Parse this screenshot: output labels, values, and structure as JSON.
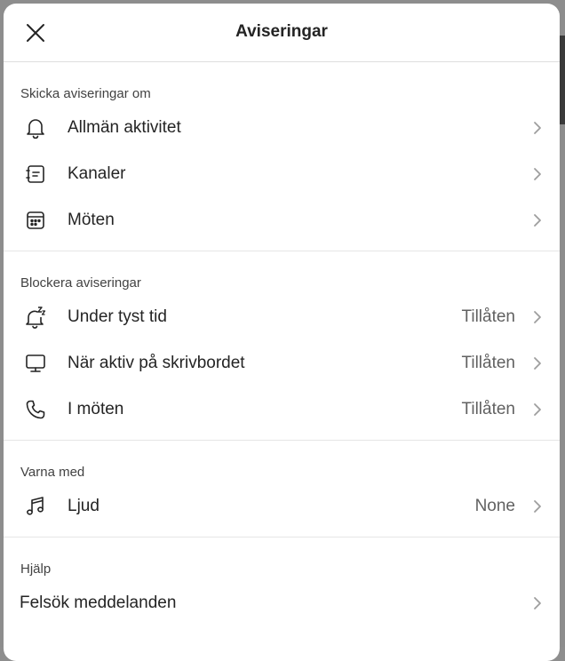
{
  "header": {
    "title": "Aviseringar"
  },
  "sections": [
    {
      "title": "Skicka aviseringar om",
      "items": [
        {
          "label": "Allmän aktivitet",
          "value": ""
        },
        {
          "label": "Kanaler",
          "value": ""
        },
        {
          "label": "Möten",
          "value": ""
        }
      ]
    },
    {
      "title": "Blockera aviseringar",
      "items": [
        {
          "label": "Under tyst tid",
          "value": "Tillåten"
        },
        {
          "label": "När aktiv på skrivbordet",
          "value": "Tillåten"
        },
        {
          "label": "I möten",
          "value": "Tillåten"
        }
      ]
    },
    {
      "title": "Varna med",
      "items": [
        {
          "label": "Ljud",
          "value": "None"
        }
      ]
    },
    {
      "title": "Hjälp",
      "items": [
        {
          "label": "Felsök meddelanden",
          "value": ""
        }
      ]
    }
  ],
  "icons": {
    "close": "close-icon",
    "chevron": "chevron-right-icon",
    "items": [
      "bell-icon",
      "channel-icon",
      "calendar-icon",
      "snooze-bell-icon",
      "monitor-icon",
      "phone-icon",
      "music-note-icon"
    ]
  },
  "colors": {
    "text": "#242424",
    "secondary": "#616161",
    "chevron": "#9e9e9e",
    "divider": "#e6e6e6"
  }
}
